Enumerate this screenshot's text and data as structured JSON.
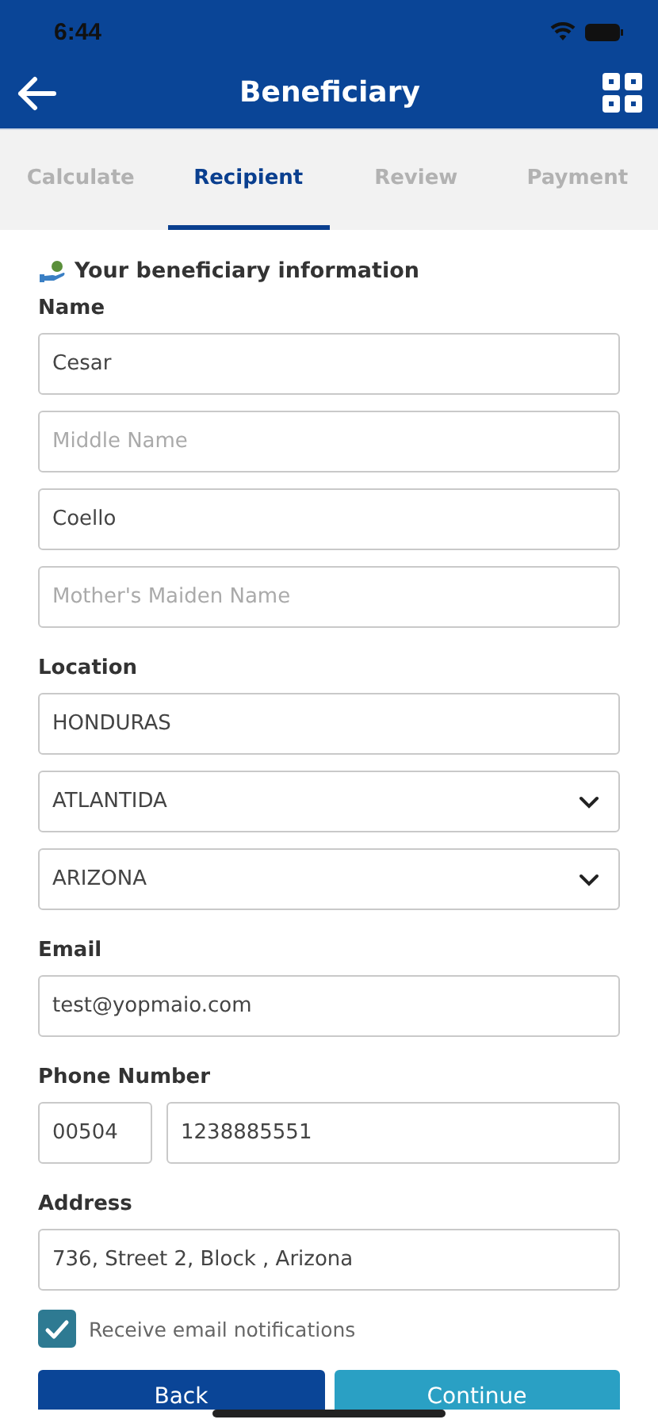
{
  "status_bar": {
    "time": "6:44"
  },
  "header": {
    "title": "Beneficiary"
  },
  "tabs": [
    {
      "label": "Calculate",
      "selected": false
    },
    {
      "label": "Recipient",
      "selected": true
    },
    {
      "label": "Review",
      "selected": false
    },
    {
      "label": "Payment",
      "selected": false
    }
  ],
  "section_title": "Your beneficiary information",
  "groups": [
    {
      "label": "Name",
      "rows": [
        [
          {
            "kind": "text",
            "value": "Cesar"
          }
        ],
        [
          {
            "kind": "text",
            "placeholder": "Middle Name"
          }
        ],
        [
          {
            "kind": "text",
            "value": "Coello"
          }
        ],
        [
          {
            "kind": "text",
            "placeholder": "Mother's Maiden Name"
          }
        ]
      ]
    },
    {
      "label": "Location",
      "rows": [
        [
          {
            "kind": "text",
            "value": "HONDURAS"
          }
        ],
        [
          {
            "kind": "select",
            "value": "ATLANTIDA"
          }
        ],
        [
          {
            "kind": "select",
            "value": "ARIZONA"
          }
        ]
      ]
    },
    {
      "label": "Email",
      "rows": [
        [
          {
            "kind": "text",
            "value": "test@yopmaio.com"
          }
        ]
      ]
    },
    {
      "label": "Phone Number",
      "rows": [
        [
          {
            "kind": "code",
            "value": "00504"
          },
          {
            "kind": "text",
            "value": "1238885551"
          }
        ]
      ]
    },
    {
      "label": "Address",
      "rows": [
        [
          {
            "kind": "text",
            "value": "736, Street 2, Block , Arizona"
          }
        ]
      ]
    }
  ],
  "notifications": {
    "label": "Receive email notifications",
    "checked": true
  },
  "buttons": [
    {
      "label": "Back",
      "kind": "secondary"
    },
    {
      "label": "Continue",
      "kind": "primary"
    }
  ]
}
